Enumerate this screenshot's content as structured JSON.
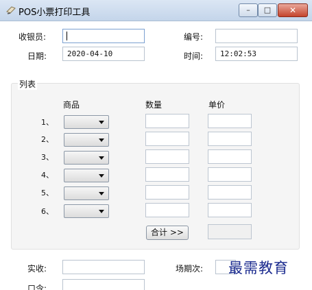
{
  "window": {
    "title": "POS小票打印工具",
    "minimize_glyph": "–",
    "maximize_glyph": "□",
    "close_glyph": "✕"
  },
  "form": {
    "cashier_label": "收银员:",
    "cashier_value": "",
    "number_label": "编号:",
    "number_value": "",
    "date_label": "日期:",
    "date_value": "2020-04-10",
    "time_label": "时间:",
    "time_value": "12:02:53"
  },
  "list": {
    "title": "列表",
    "col_product": "商品",
    "col_quantity": "数量",
    "col_price": "单价",
    "rows": [
      {
        "num": "1、"
      },
      {
        "num": "2、"
      },
      {
        "num": "3、"
      },
      {
        "num": "4、"
      },
      {
        "num": "5、"
      },
      {
        "num": "6、"
      }
    ],
    "total_button": "合计 >>",
    "total_value": ""
  },
  "footer": {
    "received_label": "实收:",
    "received_value": "",
    "session_label": "场期次:",
    "password_label": "口令:",
    "password_value": ""
  },
  "watermark": "最需教育",
  "colors": {
    "accent": "#1b2b8f",
    "close": "#c4442c"
  }
}
